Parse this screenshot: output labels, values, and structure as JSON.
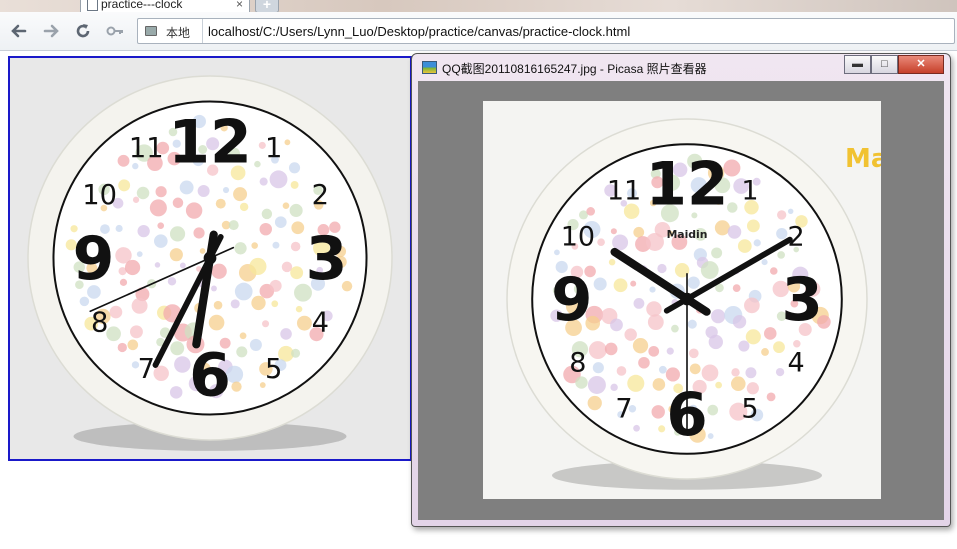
{
  "browser": {
    "tab_title": "practice---clock",
    "tab_close": "×",
    "new_tab": "+",
    "location_chip": "本地",
    "url": "localhost/C:/Users/Lynn_Luo/Desktop/practice/canvas/practice-clock.html",
    "icons": {
      "back": "back-arrow-icon",
      "forward": "forward-arrow-icon",
      "reload": "reload-icon",
      "key": "key-icon"
    }
  },
  "clock": {
    "numerals": [
      "12",
      "1",
      "2",
      "3",
      "4",
      "5",
      "6",
      "7",
      "8",
      "9",
      "10",
      "11"
    ],
    "time": {
      "hour": 6.3,
      "minute": 34.5,
      "second": 41
    },
    "frame_color": "#f4f3ee",
    "canvas_border_color": "#1a19c9"
  },
  "picasa": {
    "window_title": "QQ截图20110816165247.jpg - Picasa 照片查看器",
    "buttons": {
      "minimize": "▬",
      "maximize": "□",
      "close": "✕"
    },
    "photo": {
      "brand": "Maidin",
      "logo_text": "Ma",
      "numerals": [
        "12",
        "1",
        "2",
        "3",
        "4",
        "5",
        "6",
        "7",
        "8",
        "9",
        "10",
        "11"
      ],
      "time": {
        "hour": 10.1,
        "minute": 10,
        "second": 30
      }
    }
  }
}
